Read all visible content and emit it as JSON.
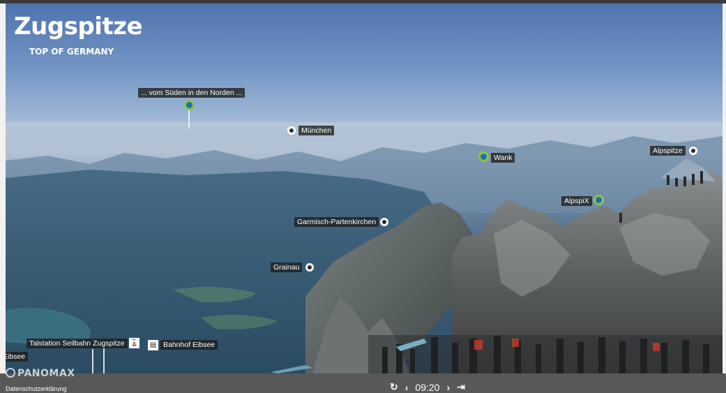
{
  "brand": {
    "title": "Zugspitze",
    "subtitle": "TOP OF GERMANY",
    "powered_by": "PANOMAX"
  },
  "pois": {
    "headline": "... vom Süden in den Norden ...",
    "muenchen": "München",
    "wank": "Wank",
    "alpspitze": "Alpspitze",
    "alpspix": "AlpspiX",
    "garmisch": "Garmisch-Partenkirchen",
    "grainau": "Grainau",
    "talstation": "Talstation Seilbahn Zugspitze",
    "bahnhof": "Bahnhof Eibsee",
    "eibsee": "Eibsee"
  },
  "footer": {
    "privacy": "Datenschutzerklärung"
  },
  "player": {
    "replay_icon": "replay-icon",
    "prev_icon": "chevron-left-icon",
    "time": "09:20",
    "next_icon": "chevron-right-icon",
    "last_icon": "skip-end-icon"
  },
  "colors": {
    "marker_green": "#8dc63f",
    "marker_blue": "#1f6fb8",
    "label_bg": "#1e1e1e",
    "bottom_bar": "#585858"
  }
}
